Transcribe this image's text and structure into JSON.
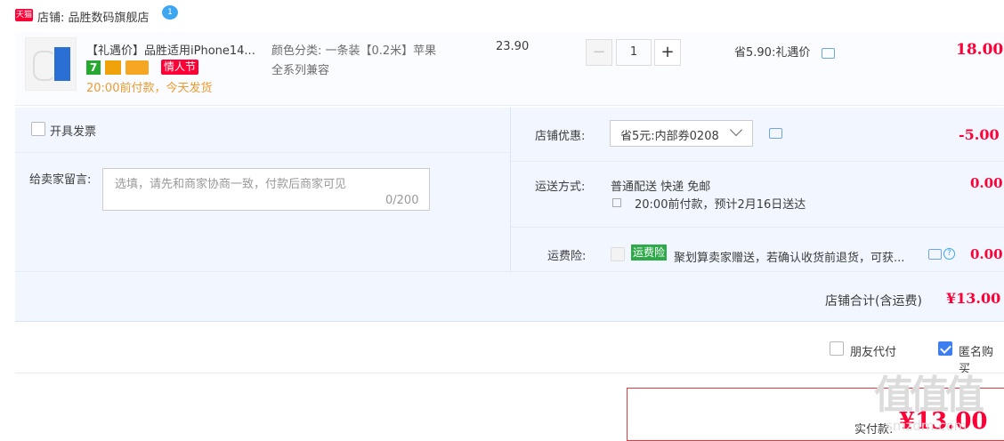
{
  "store": {
    "badge": "天猫",
    "label": "店铺: 品胜数码旗舰店",
    "chat_badge": "1"
  },
  "item": {
    "title": "【礼遇价】品胜适用iPhone14...",
    "badge_seven": "7",
    "badge_valentine": "情人节",
    "ship_note": "20:00前付款，今天发货",
    "spec_line1": "颜色分类: 一条装【0.2米】苹果",
    "spec_line2": "全系列兼容",
    "unit_price": "23.90",
    "quantity": "1",
    "minus": "−",
    "plus": "+",
    "save_note": "省5.90:礼遇价",
    "total": "18.00"
  },
  "invoice": {
    "label": "开具发票"
  },
  "message": {
    "label": "给卖家留言:",
    "placeholder": "选填，请先和商家协商一致，付款后商家可见",
    "counter": "0/200"
  },
  "discount": {
    "label": "店铺优惠:",
    "selected": "省5元:内部券0208",
    "value": "-5.00"
  },
  "shipping": {
    "label": "运送方式:",
    "method": "普通配送 快递 免邮",
    "estimate": "20:00前付款，预计2月16日送达",
    "value": "0.00"
  },
  "insurance": {
    "label": "运费险:",
    "tag": "运费险",
    "desc": "聚划算卖家赠送，若确认收货前退货，可获...",
    "help": "?",
    "value": "0.00"
  },
  "store_total": {
    "label": "店铺合计(含运费)",
    "value": "¥13.00"
  },
  "options": {
    "friend_pay": "朋友代付",
    "anonymous": "匿名购买"
  },
  "payment": {
    "label": "实付款:",
    "value": "¥13.00"
  },
  "watermark": {
    "text": "值值值",
    "url": "smzdm.com"
  },
  "colors": {
    "accent_red": "#ff0036",
    "panel_bg": "#f2f7ff",
    "link_blue": "#3da6f0"
  }
}
